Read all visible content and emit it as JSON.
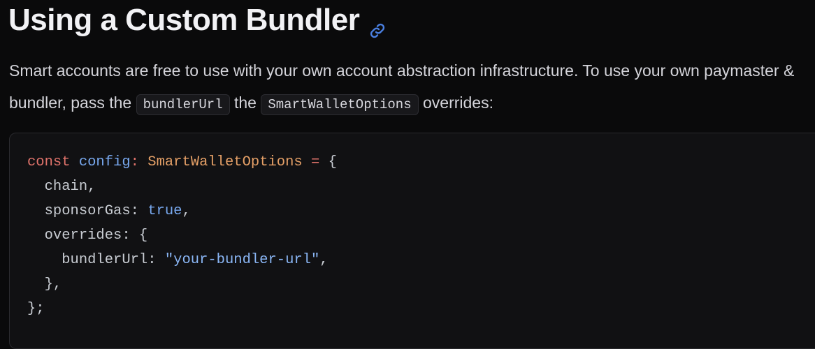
{
  "heading": {
    "title": "Using a Custom Bundler",
    "anchor_icon": "link-icon",
    "anchor_color": "#4a7fe0"
  },
  "paragraph": {
    "text_1": "Smart accounts are free to use with your own account abstraction infrastructure. To use your own paymaster & bundler, pass the",
    "code_1": "bundlerUrl",
    "text_2": "the",
    "code_2": "SmartWalletOptions",
    "text_3": "overrides:"
  },
  "code": {
    "l1_kw": "const",
    "l1_var": "config",
    "l1_colon": ":",
    "l1_type": "SmartWalletOptions",
    "l1_eq": "=",
    "l1_brace": "{",
    "l2": "chain,",
    "l3_key": "sponsorGas:",
    "l3_val": "true",
    "l3_end": ",",
    "l4": "overrides: {",
    "l5_key": "bundlerUrl:",
    "l5_val": "\"your-bundler-url\"",
    "l5_end": ",",
    "l6": "},",
    "l7": "};"
  }
}
